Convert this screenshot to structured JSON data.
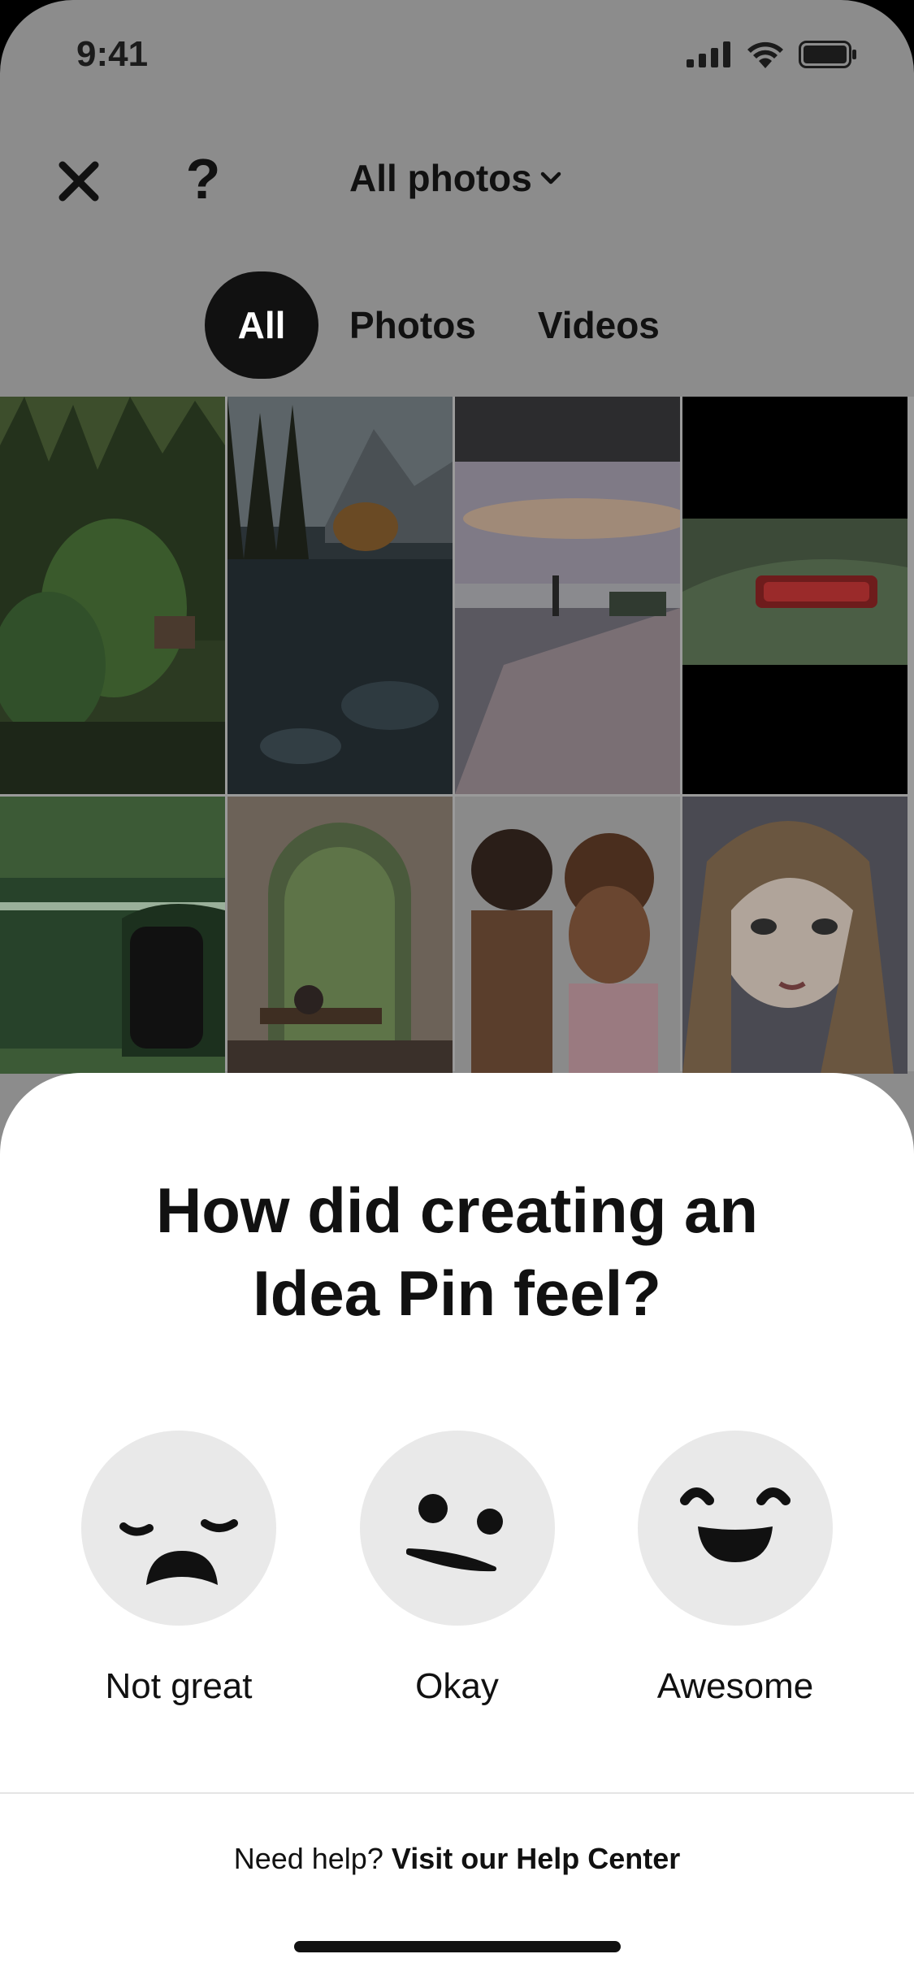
{
  "status_bar": {
    "time": "9:41",
    "icons": [
      "signal-icon",
      "wifi-icon",
      "battery-icon"
    ]
  },
  "header": {
    "close_icon": "close-icon",
    "help_label": "?",
    "album_label": "All photos",
    "album_icon": "chevron-down-icon"
  },
  "filters": [
    {
      "label": "All",
      "selected": true
    },
    {
      "label": "Photos",
      "selected": false
    },
    {
      "label": "Videos",
      "selected": false
    }
  ],
  "feedback": {
    "question_line1": "How did creating an",
    "question_line2": "Idea Pin feel?",
    "options": [
      {
        "label": "Not great",
        "icon": "sad-face-icon"
      },
      {
        "label": "Okay",
        "icon": "neutral-face-icon"
      },
      {
        "label": "Awesome",
        "icon": "happy-face-icon"
      }
    ],
    "help_prefix": "Need help?",
    "help_link": "Visit our Help Center"
  },
  "colors": {
    "overlay": "#8c8c8c",
    "chip_active": "#111111",
    "face_bg": "#e9e9e9"
  }
}
